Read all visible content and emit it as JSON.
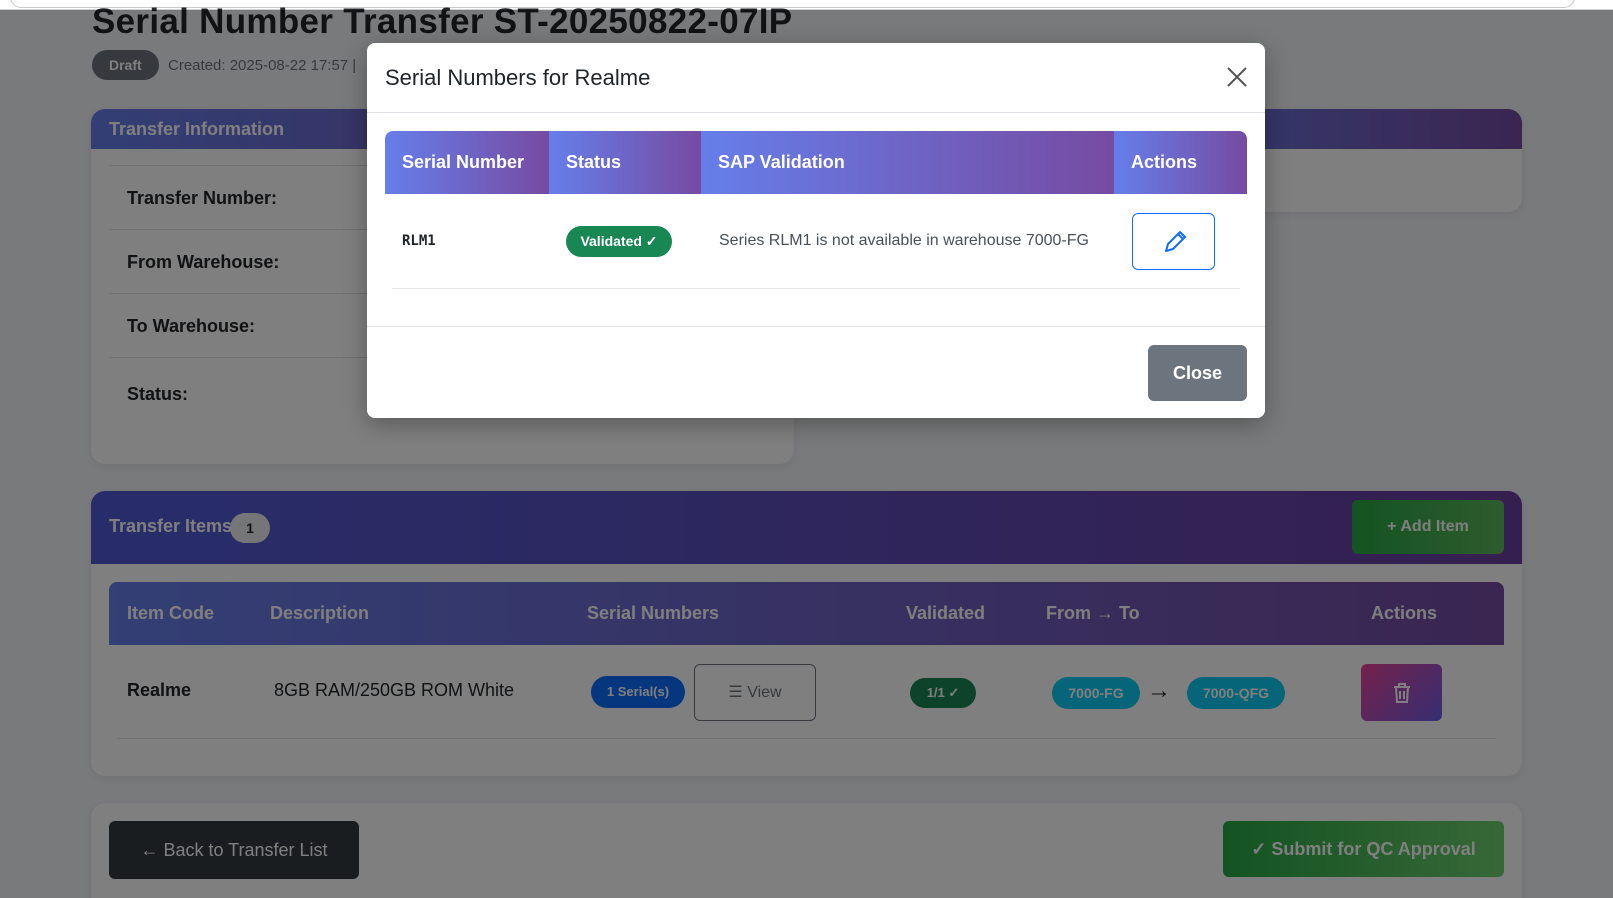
{
  "page": {
    "title": "Serial Number Transfer ST-20250822-07IP",
    "status_badge": "Draft",
    "created_text": "Created: 2025-08-22 17:57 | "
  },
  "transfer_info": {
    "header": "Transfer Information",
    "labels": [
      "Transfer Number:",
      "From Warehouse:",
      "To Warehouse:",
      "Status:"
    ]
  },
  "transfer_items": {
    "header": "Transfer Items",
    "count": "1",
    "add_item_label": "Add Item",
    "columns": [
      "Item Code",
      "Description",
      "Serial Numbers",
      "Validated",
      "From → To",
      "Actions"
    ],
    "rows": [
      {
        "item_code": "Realme",
        "description": "8GB RAM/250GB ROM White",
        "serial_count": "1 Serial(s)",
        "view_label": "View",
        "validated": "1/1 ✓",
        "from_wh": "7000-FG",
        "to_wh": "7000-QFG"
      }
    ]
  },
  "footer": {
    "back_label": "Back to Transfer List",
    "submit_label": "Submit for QC Approval"
  },
  "modal": {
    "title": "Serial Numbers for Realme",
    "columns": [
      "Serial Number",
      "Status",
      "SAP Validation",
      "Actions"
    ],
    "rows": [
      {
        "serial": "RLM1",
        "status": "Validated ✓",
        "sap_validation": "Series RLM1 is not available in warehouse 7000-FG"
      }
    ],
    "close_label": "Close"
  },
  "colors": {
    "header_gradient_start": "#667eea",
    "header_gradient_end": "#764ba2",
    "success": "#198754",
    "primary": "#0d6efd",
    "info": "#0dcaf0",
    "secondary": "#6c757d"
  }
}
